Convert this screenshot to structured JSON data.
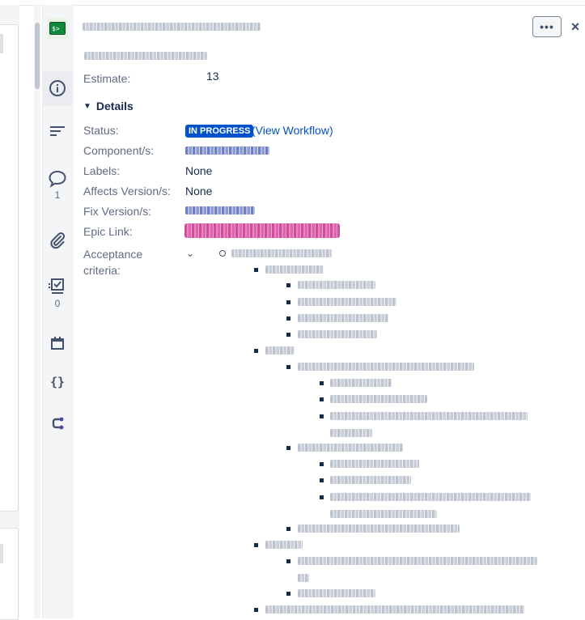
{
  "header": {
    "more_label": "•••",
    "close_label": "×"
  },
  "rail": {
    "comments_count": "1",
    "checklist_count": "0"
  },
  "fields": {
    "estimate_label": "Estimate:",
    "estimate_value": "13",
    "details_label": "Details",
    "status_label": "Status:",
    "status_value": "IN PROGRESS",
    "view_workflow": "(View Workflow)",
    "component_label": "Component/s:",
    "labels_label": "Labels:",
    "labels_value": "None",
    "affects_label": "Affects Version/s:",
    "affects_value": "None",
    "fix_label": "Fix Version/s:",
    "epic_label": "Epic Link:",
    "acceptance_label_1": "Acceptance",
    "acceptance_label_2": "criteria:"
  },
  "colors": {
    "status_badge": "#0052cc",
    "link": "#0052cc",
    "epic": "#d54a9b"
  }
}
